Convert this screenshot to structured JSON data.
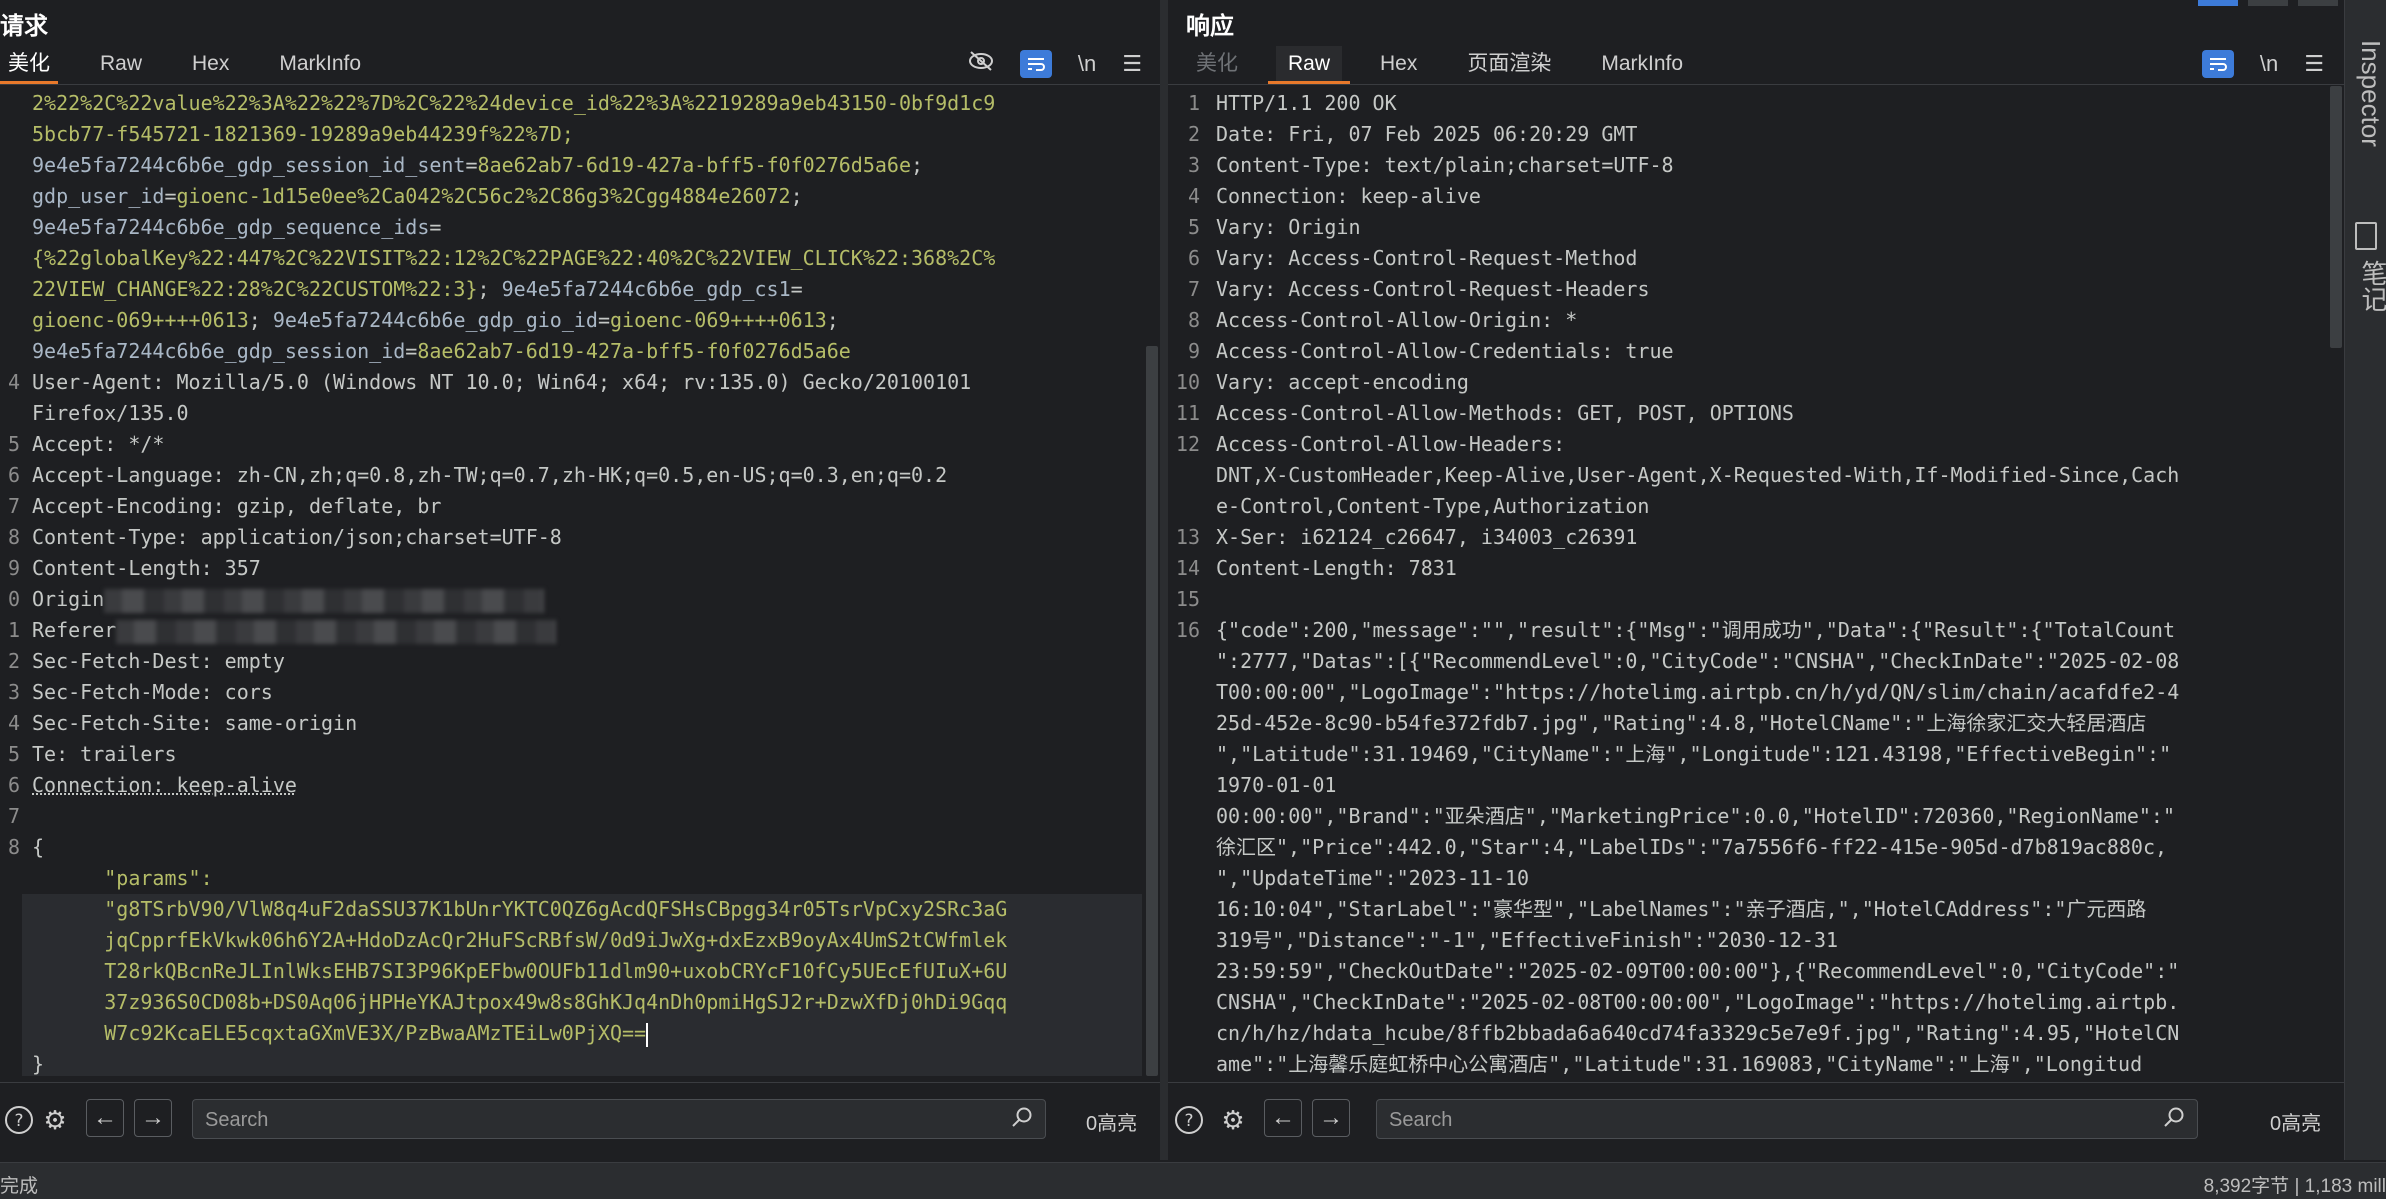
{
  "request": {
    "title": "请求",
    "tabs": [
      "美化",
      "Raw",
      "Hex",
      "MarkInfo"
    ],
    "active_tab": "美化",
    "lines": [
      {
        "n": "",
        "parts": [
          [
            "cv",
            "2%22%2C%22value%22%3A%22%22%7D%2C%22%24device_id%22%3A%2219289a9eb43150-0bf9d1c9"
          ]
        ]
      },
      {
        "n": "",
        "parts": [
          [
            "cv",
            "5bcb77-f545721-1821369-19289a9eb44239f%22%7D;"
          ]
        ]
      },
      {
        "n": "",
        "parts": [
          [
            "ck",
            "9e4e5fa7244c6b6e_gdp_session_id_sent"
          ],
          [
            "hk",
            "="
          ],
          [
            "cv",
            "8ae62ab7-6d19-427a-bff5-f0f0276d5a6e"
          ],
          [
            "hk",
            ";"
          ]
        ]
      },
      {
        "n": "",
        "parts": [
          [
            "ck",
            "gdp_user_id"
          ],
          [
            "hk",
            "="
          ],
          [
            "cv",
            "gioenc-1d15e0ee%2Ca042%2C56c2%2C86g3%2Cgg4884e26072"
          ],
          [
            "hk",
            ";"
          ]
        ]
      },
      {
        "n": "",
        "parts": [
          [
            "ck",
            "9e4e5fa7244c6b6e_gdp_sequence_ids"
          ],
          [
            "hk",
            "="
          ]
        ]
      },
      {
        "n": "",
        "parts": [
          [
            "cv",
            "{%22globalKey%22:447%2C%22VISIT%22:12%2C%22PAGE%22:40%2C%22VIEW_CLICK%22:368%2C%"
          ]
        ]
      },
      {
        "n": "",
        "parts": [
          [
            "cv",
            "22VIEW_CHANGE%22:28%2C%22CUSTOM%22:3}"
          ],
          [
            "hk",
            "; "
          ],
          [
            "ck",
            "9e4e5fa7244c6b6e_gdp_cs1"
          ],
          [
            "hk",
            "="
          ]
        ]
      },
      {
        "n": "",
        "parts": [
          [
            "cv",
            "gioenc-069++++0613"
          ],
          [
            "hk",
            "; "
          ],
          [
            "ck",
            "9e4e5fa7244c6b6e_gdp_gio_id"
          ],
          [
            "hk",
            "="
          ],
          [
            "cv",
            "gioenc-069++++0613"
          ],
          [
            "hk",
            ";"
          ]
        ]
      },
      {
        "n": "",
        "parts": [
          [
            "ck",
            "9e4e5fa7244c6b6e_gdp_session_id"
          ],
          [
            "hk",
            "="
          ],
          [
            "cv",
            "8ae62ab7-6d19-427a-bff5-f0f0276d5a6e"
          ]
        ]
      },
      {
        "n": "4",
        "parts": [
          [
            "hk",
            "User-Agent"
          ],
          [
            "hv",
            ": Mozilla/5.0 (Windows NT 10.0; Win64; x64; rv:135.0) Gecko/20100101"
          ]
        ]
      },
      {
        "n": "",
        "parts": [
          [
            "hv",
            "Firefox/135.0"
          ]
        ]
      },
      {
        "n": "5",
        "parts": [
          [
            "hk",
            "Accept"
          ],
          [
            "hv",
            ": */*"
          ]
        ]
      },
      {
        "n": "6",
        "parts": [
          [
            "hk",
            "Accept-Language"
          ],
          [
            "hv",
            ": zh-CN,zh;q=0.8,zh-TW;q=0.7,zh-HK;q=0.5,en-US;q=0.3,en;q=0.2"
          ]
        ]
      },
      {
        "n": "7",
        "parts": [
          [
            "hk",
            "Accept-Encoding"
          ],
          [
            "hv",
            ": gzip, deflate, br"
          ]
        ]
      },
      {
        "n": "8",
        "parts": [
          [
            "hk",
            "Content-Type"
          ],
          [
            "hv",
            ": application/json;charset=UTF-8"
          ]
        ]
      },
      {
        "n": "9",
        "parts": [
          [
            "hk",
            "Content-Length"
          ],
          [
            "hv",
            ": 357"
          ]
        ]
      },
      {
        "n": "0",
        "parts": [
          [
            "hk",
            "Origin"
          ],
          [
            "blur",
            ""
          ]
        ]
      },
      {
        "n": "1",
        "parts": [
          [
            "hk",
            "Referer"
          ],
          [
            "blur",
            ""
          ]
        ]
      },
      {
        "n": "2",
        "parts": [
          [
            "hk",
            "Sec-Fetch-Dest"
          ],
          [
            "hv",
            ": empty"
          ]
        ]
      },
      {
        "n": "3",
        "parts": [
          [
            "hk",
            "Sec-Fetch-Mode"
          ],
          [
            "hv",
            ": cors"
          ]
        ]
      },
      {
        "n": "4",
        "parts": [
          [
            "hk",
            "Sec-Fetch-Site"
          ],
          [
            "hv",
            ": same-origin"
          ]
        ]
      },
      {
        "n": "5",
        "parts": [
          [
            "hk",
            "Te"
          ],
          [
            "hv",
            ": trailers"
          ]
        ]
      },
      {
        "n": "6",
        "parts": [
          [
            "hk",
            "Connection: keep-alive"
          ]
        ]
      },
      {
        "n": "7",
        "parts": []
      },
      {
        "n": "8",
        "parts": [
          [
            "hk",
            "{"
          ]
        ]
      },
      {
        "n": "",
        "parts": [
          [
            "jstr",
            "      \"params\":"
          ]
        ]
      },
      {
        "n": "",
        "parts": [
          [
            "jstr",
            "      \"g8TSrbV90/VlW8q4uF2daSSU37K1bUnrYKTC0QZ6gAcdQFSHsCBpgg34r05TsrVpCxy2SRc3aG"
          ]
        ]
      },
      {
        "n": "",
        "parts": [
          [
            "jstr",
            "      jqCpprfEkVkwk06h6Y2A+HdoDzAcQr2HuFScRBfsW/0d9iJwXg+dxEzxB9oyAx4UmS2tCWfmlek"
          ]
        ]
      },
      {
        "n": "",
        "parts": [
          [
            "jstr",
            "      T28rkQBcnReJLInlWksEHB7SI3P96KpEFbw0OUFb11dlm90+uxobCRYcF10fCy5UEcEfUIuX+6U"
          ]
        ]
      },
      {
        "n": "",
        "parts": [
          [
            "jstr",
            "      37z936S0CD08b+DS0Aq06jHPHeYKAJtpox49w8s8GhKJq4nDh0pmiHgSJ2r+DzwXfDj0hDi9Gqq"
          ]
        ]
      },
      {
        "n": "",
        "parts": [
          [
            "jstr",
            "      W7c92KcaELE5cqxtaGXmVE3X/PzBwaAMzTEiLw0PjXQ=="
          ],
          [
            "caret",
            ""
          ]
        ]
      },
      {
        "n": "",
        "parts": [
          [
            "hk",
            "}"
          ]
        ]
      }
    ],
    "search_placeholder": "Search",
    "highlight_count": "0高亮"
  },
  "response": {
    "title": "响应",
    "tabs": [
      "美化",
      "Raw",
      "Hex",
      "页面渲染",
      "MarkInfo"
    ],
    "active_tab": "Raw",
    "lines": [
      {
        "n": "1",
        "parts": [
          [
            "hk",
            "HTTP/1.1 200 OK"
          ]
        ]
      },
      {
        "n": "2",
        "parts": [
          [
            "hk",
            "Date"
          ],
          [
            "hv",
            ": Fri, 07 Feb 2025 06:20:29 GMT"
          ]
        ]
      },
      {
        "n": "3",
        "parts": [
          [
            "hk",
            "Content-Type"
          ],
          [
            "hv",
            ": text/plain;charset=UTF-8"
          ]
        ]
      },
      {
        "n": "4",
        "parts": [
          [
            "hk",
            "Connection"
          ],
          [
            "hv",
            ": keep-alive"
          ]
        ]
      },
      {
        "n": "5",
        "parts": [
          [
            "hk",
            "Vary"
          ],
          [
            "hv",
            ": Origin"
          ]
        ]
      },
      {
        "n": "6",
        "parts": [
          [
            "hk",
            "Vary"
          ],
          [
            "hv",
            ": Access-Control-Request-Method"
          ]
        ]
      },
      {
        "n": "7",
        "parts": [
          [
            "hk",
            "Vary"
          ],
          [
            "hv",
            ": Access-Control-Request-Headers"
          ]
        ]
      },
      {
        "n": "8",
        "parts": [
          [
            "hk",
            "Access-Control-Allow-Origin"
          ],
          [
            "hv",
            ": *"
          ]
        ]
      },
      {
        "n": "9",
        "parts": [
          [
            "hk",
            "Access-Control-Allow-Credentials"
          ],
          [
            "hv",
            ": true"
          ]
        ]
      },
      {
        "n": "10",
        "parts": [
          [
            "hk",
            "Vary"
          ],
          [
            "hv",
            ": accept-encoding"
          ]
        ]
      },
      {
        "n": "11",
        "parts": [
          [
            "hk",
            "Access-Control-Allow-Methods"
          ],
          [
            "hv",
            ": GET, POST, OPTIONS"
          ]
        ]
      },
      {
        "n": "12",
        "parts": [
          [
            "hk",
            "Access-Control-Allow-Headers"
          ],
          [
            "hv",
            ":"
          ]
        ]
      },
      {
        "n": "",
        "parts": [
          [
            "hv",
            "DNT,X-CustomHeader,Keep-Alive,User-Agent,X-Requested-With,If-Modified-Since,Cach"
          ]
        ]
      },
      {
        "n": "",
        "parts": [
          [
            "hv",
            "e-Control,Content-Type,Authorization"
          ]
        ]
      },
      {
        "n": "13",
        "parts": [
          [
            "hk",
            "X-Ser"
          ],
          [
            "hv",
            ": i62124_c26647, i34003_c26391"
          ]
        ]
      },
      {
        "n": "14",
        "parts": [
          [
            "hk",
            "Content-Length"
          ],
          [
            "hv",
            ": 7831"
          ]
        ]
      },
      {
        "n": "15",
        "parts": []
      },
      {
        "n": "16",
        "parts": [
          [
            "hv",
            "{\"code\":200,\"message\":\"\",\"result\":{\"Msg\":\"调用成功\",\"Data\":{\"Result\":{\"TotalCount"
          ]
        ]
      },
      {
        "n": "",
        "parts": [
          [
            "hv",
            "\":2777,\"Datas\":[{\"RecommendLevel\":0,\"CityCode\":\"CNSHA\",\"CheckInDate\":\"2025-02-08"
          ]
        ]
      },
      {
        "n": "",
        "parts": [
          [
            "hv",
            "T00:00:00\",\"LogoImage\":\"https://hotelimg.airtpb.cn/h/yd/QN/slim/chain/acafdfe2-4"
          ]
        ]
      },
      {
        "n": "",
        "parts": [
          [
            "hv",
            "25d-452e-8c90-b54fe372fdb7.jpg\",\"Rating\":4.8,\"HotelCName\":\"上海徐家汇交大轻居酒店"
          ]
        ]
      },
      {
        "n": "",
        "parts": [
          [
            "hv",
            "\",\"Latitude\":31.19469,\"CityName\":\"上海\",\"Longitude\":121.43198,\"EffectiveBegin\":\""
          ]
        ]
      },
      {
        "n": "",
        "parts": [
          [
            "hv",
            "1970-01-01"
          ]
        ]
      },
      {
        "n": "",
        "parts": [
          [
            "hv",
            "00:00:00\",\"Brand\":\"亚朵酒店\",\"MarketingPrice\":0.0,\"HotelID\":720360,\"RegionName\":\""
          ]
        ]
      },
      {
        "n": "",
        "parts": [
          [
            "hv",
            "徐汇区\",\"Price\":442.0,\"Star\":4,\"LabelIDs\":\"7a7556f6-ff22-415e-905d-d7b819ac880c,"
          ]
        ]
      },
      {
        "n": "",
        "parts": [
          [
            "hv",
            "\",\"UpdateTime\":\"2023-11-10"
          ]
        ]
      },
      {
        "n": "",
        "parts": [
          [
            "hv",
            "16:10:04\",\"StarLabel\":\"豪华型\",\"LabelNames\":\"亲子酒店,\",\"HotelCAddress\":\"广元西路"
          ]
        ]
      },
      {
        "n": "",
        "parts": [
          [
            "hv",
            "319号\",\"Distance\":\"-1\",\"EffectiveFinish\":\"2030-12-31"
          ]
        ]
      },
      {
        "n": "",
        "parts": [
          [
            "hv",
            "23:59:59\",\"CheckOutDate\":\"2025-02-09T00:00:00\"},{\"RecommendLevel\":0,\"CityCode\":\""
          ]
        ]
      },
      {
        "n": "",
        "parts": [
          [
            "hv",
            "CNSHA\",\"CheckInDate\":\"2025-02-08T00:00:00\",\"LogoImage\":\"https://hotelimg.airtpb."
          ]
        ]
      },
      {
        "n": "",
        "parts": [
          [
            "hv",
            "cn/h/hz/hdata_hcube/8ffb2bbada6a640cd74fa3329c5e7e9f.jpg\",\"Rating\":4.95,\"HotelCN"
          ]
        ]
      },
      {
        "n": "",
        "parts": [
          [
            "hv",
            "ame\":\"上海馨乐庭虹桥中心公寓酒店\",\"Latitude\":31.169083,\"CityName\":\"上海\",\"Longitud"
          ]
        ]
      }
    ],
    "search_placeholder": "Search",
    "highlight_count": "0高亮"
  },
  "sidebar": {
    "label": "Inspector",
    "label2": "笔记"
  },
  "statusbar": {
    "left": "完成",
    "right": "8,392字节 | 1,183 mill"
  },
  "colors": {
    "accent_tab": "#e8792b",
    "wrap_button": "#3d7bd9",
    "cookie_value": "#b5bd68",
    "cookie_key": "#a9b7c6"
  }
}
